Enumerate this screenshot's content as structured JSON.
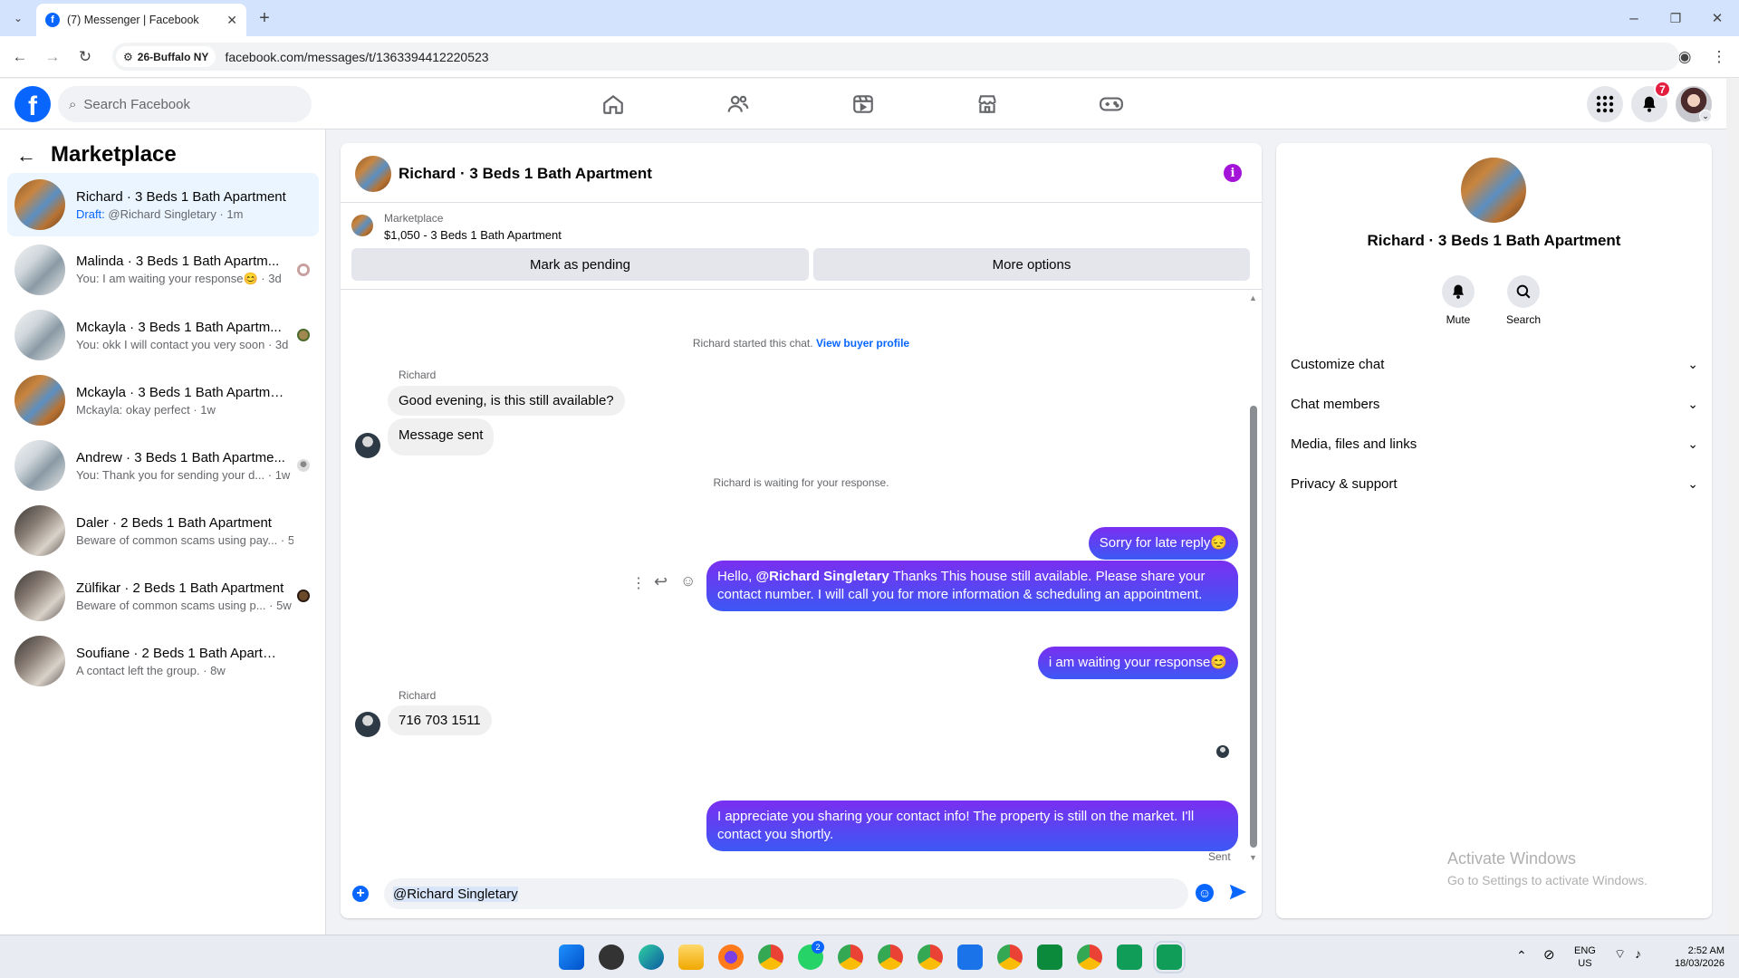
{
  "browser": {
    "tab_title": "(7) Messenger | Facebook",
    "site_chip": "26-Buffalo NY",
    "url": "facebook.com/messages/t/1363394412220523"
  },
  "fb_header": {
    "search_placeholder": "Search Facebook",
    "notification_count": "7"
  },
  "sidebar": {
    "title": "Marketplace",
    "conversations": [
      {
        "title": "Richard · 3 Beds 1 Bath Apartment",
        "draft_label": "Draft:",
        "snippet": " @Richard Singletary · 1m",
        "thumb": "house"
      },
      {
        "title": "Malinda · 3 Beds 1 Bath Apartm...",
        "snippet": "You: I am waiting your response😊 · 3d",
        "thumb": "room"
      },
      {
        "title": "Mckayla · 3 Beds 1 Bath Apartm...",
        "snippet": "You: okk I will contact you very soon · 3d",
        "thumb": "room"
      },
      {
        "title": "Mckayla · 3 Beds 1 Bath Apartment",
        "snippet": "Mckayla: okay perfect · 1w",
        "thumb": "house"
      },
      {
        "title": "Andrew · 3 Beds 1 Bath Apartme...",
        "snippet": "You: Thank you for sending your d... · 1w",
        "thumb": "room"
      },
      {
        "title": "Daler · 2 Beds 1 Bath Apartment",
        "snippet": "Beware of common scams using pay... · 5w",
        "thumb": "room2"
      },
      {
        "title": "Zülfikar · 2 Beds 1 Bath Apartment",
        "snippet": "Beware of common scams using p... · 5w",
        "thumb": "room2"
      },
      {
        "title": "Soufiane · 2 Beds 1 Bath Apartment",
        "snippet": "A contact left the group. · 8w",
        "thumb": "room2"
      }
    ]
  },
  "chat": {
    "header_title": "Richard · 3 Beds 1 Bath Apartment",
    "listing_source": "Marketplace",
    "listing_price_title": "$1,050 - 3 Beds 1 Bath Apartment",
    "mark_pending_label": "Mark as pending",
    "more_options_label": "More options",
    "started_text": "Richard started this chat.",
    "view_profile_link": "View buyer profile",
    "sender_name_1": "Richard",
    "msg_in_1": "Good evening, is this still available?",
    "msg_in_2": "Message sent",
    "waiting_text": "Richard is waiting for your response.",
    "msg_out_1": "Sorry for late reply😔",
    "msg_out_2_prefix": "Hello, ",
    "msg_out_2_mention": "@Richard Singletary",
    "msg_out_2_rest": "  Thanks This house still available. Please share your contact number. I will call you for more information & scheduling an appointment.",
    "msg_out_3": "i am waiting your response😊",
    "sender_name_2": "Richard",
    "msg_in_3": "716 703 1511",
    "msg_out_4": "I appreciate you sharing your contact info! The property is still on the market. I'll contact you shortly.",
    "sent_status": "Sent",
    "composer_value": "@Richard Singletary"
  },
  "details": {
    "title": "Richard · 3 Beds 1 Bath Apartment",
    "mute_label": "Mute",
    "search_label": "Search",
    "sections": [
      "Customize chat",
      "Chat members",
      "Media, files and links",
      "Privacy & support"
    ],
    "watermark_title": "Activate Windows",
    "watermark_sub": "Go to Settings to activate Windows."
  },
  "taskbar": {
    "lang_1": "ENG",
    "lang_2": "US",
    "time": "2:52 AM",
    "date": "18/03/2026",
    "whatsapp_badge": "2"
  },
  "colors": {
    "fb_blue": "#0866ff",
    "messenger_gradient_top": "#7a2ff0",
    "messenger_gradient_bottom": "#3c58f5",
    "notif_red": "#e41e3f"
  }
}
